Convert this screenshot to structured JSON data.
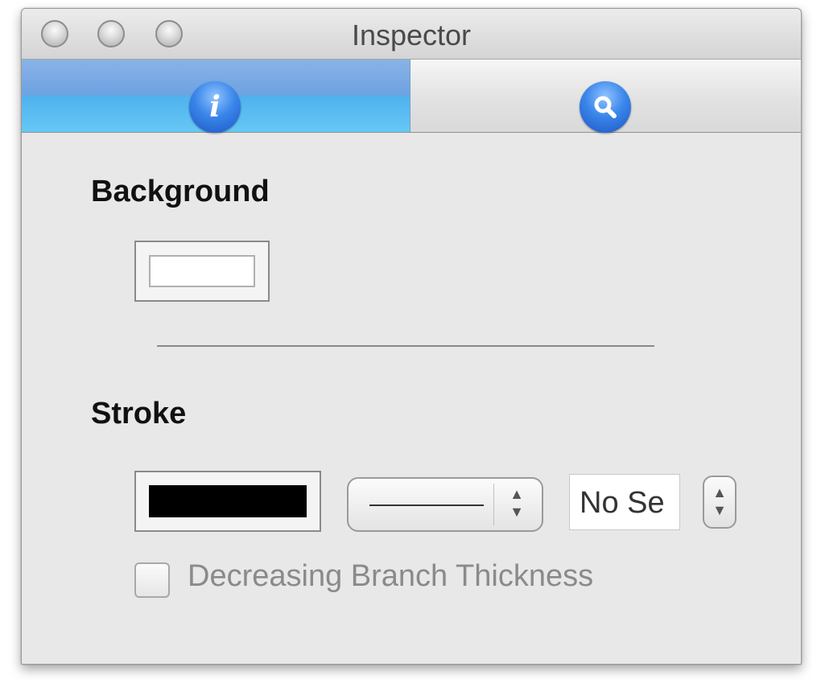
{
  "window": {
    "title": "Inspector"
  },
  "toolbar": {
    "tabs": [
      {
        "icon": "info-icon",
        "glyph": "i",
        "selected": true
      },
      {
        "icon": "magnifier-icon",
        "glyph": "",
        "selected": false
      }
    ]
  },
  "background_section": {
    "label": "Background",
    "fill_color": "#ffffff"
  },
  "stroke_section": {
    "label": "Stroke",
    "color": "#000000",
    "line_style": "solid",
    "width_field_value": "No Se",
    "decreasing_thickness_label": "Decreasing Branch Thickness",
    "decreasing_thickness_checked": false,
    "decreasing_thickness_enabled": false
  },
  "colors": {
    "selected_tab": "#6ea2e2",
    "window_bg": "#e8e8e8"
  }
}
